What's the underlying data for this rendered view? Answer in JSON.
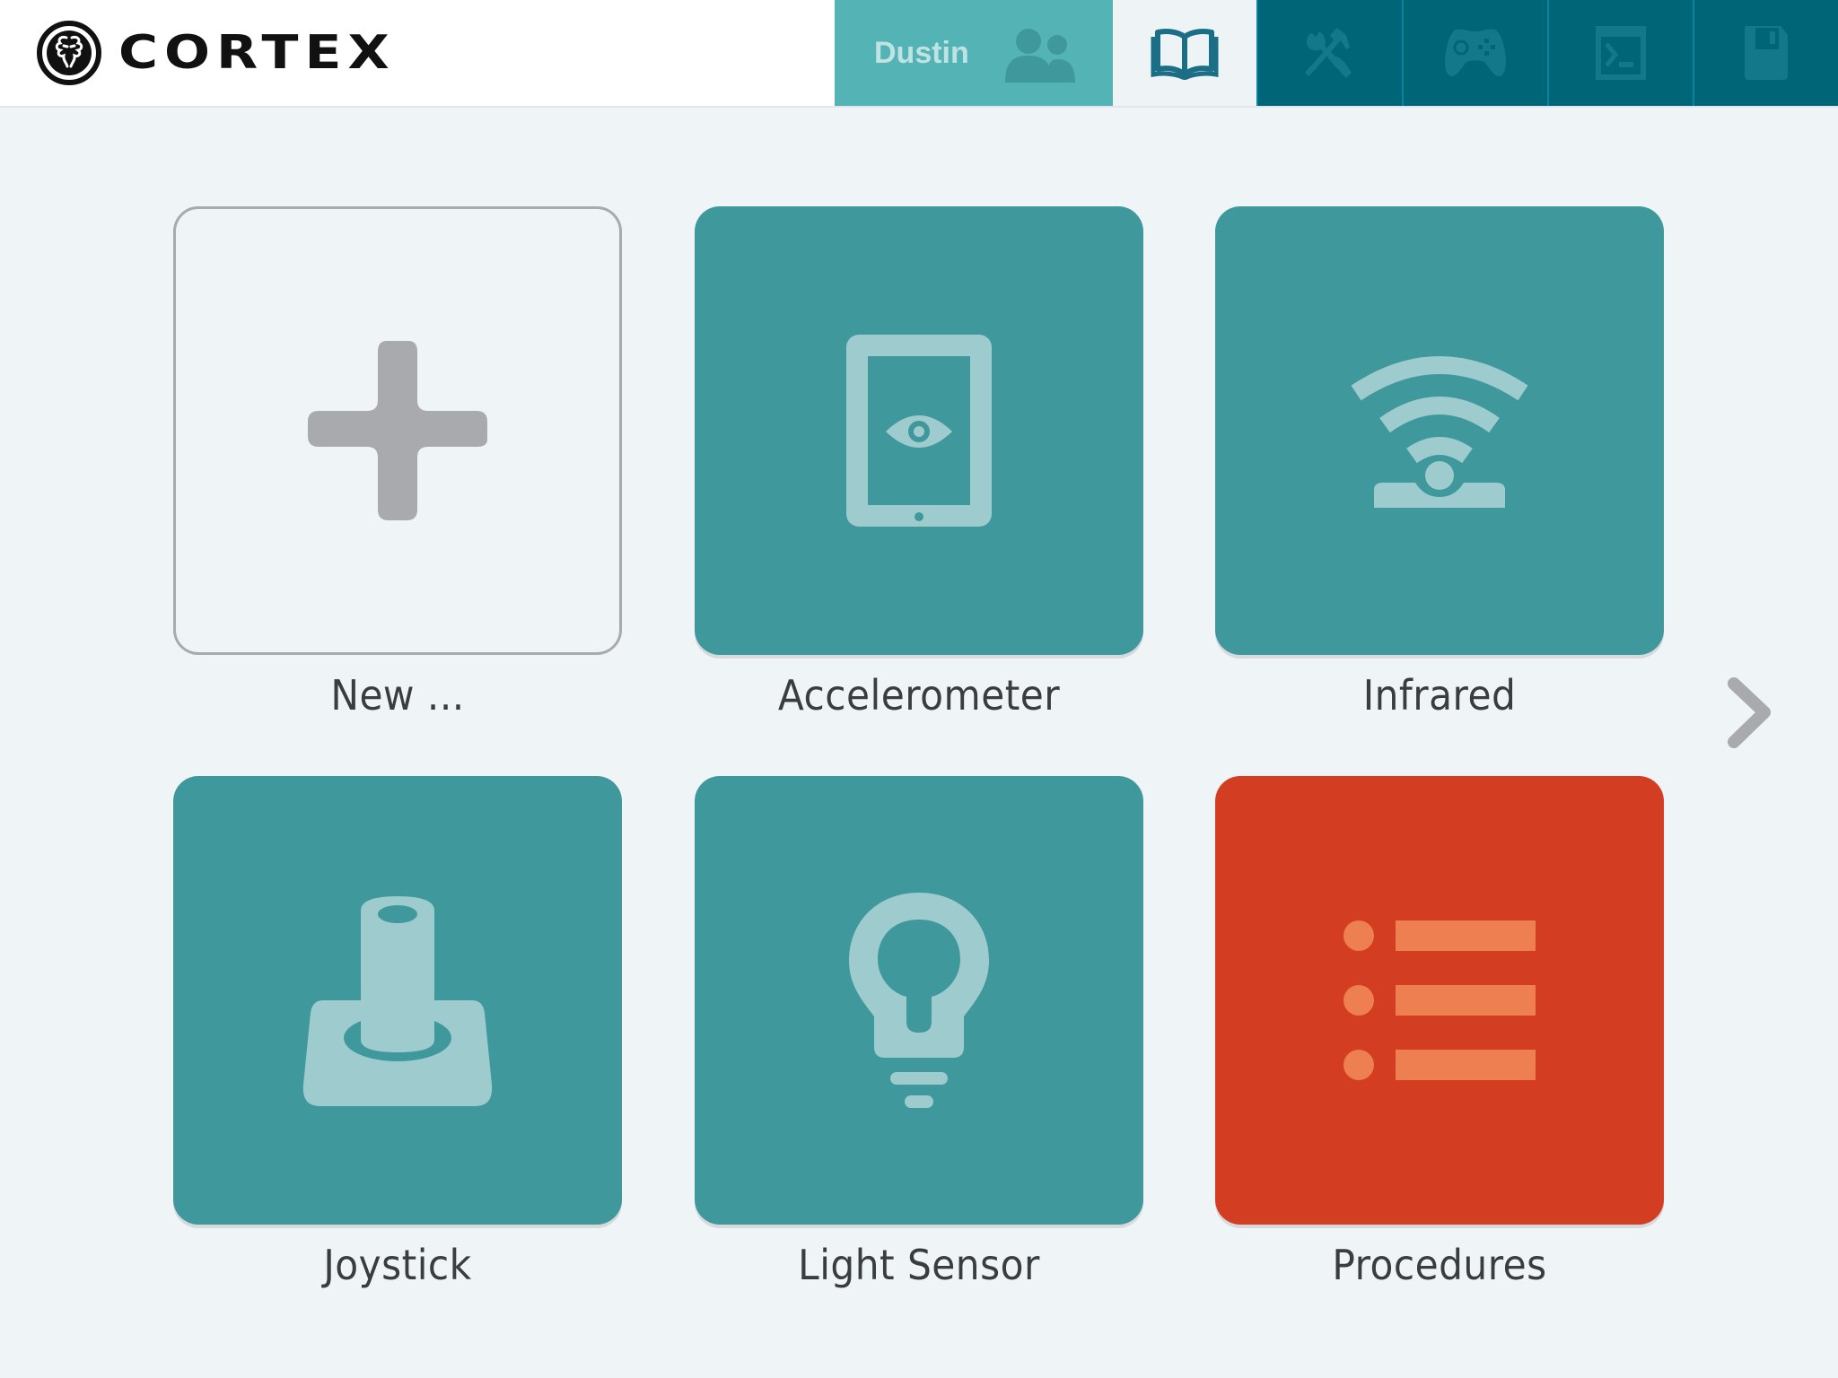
{
  "app": {
    "name": "CORTEX",
    "logo_icon": "brain-icon"
  },
  "header": {
    "user": {
      "name": "Dustin",
      "icon": "users-icon",
      "color": "#54b3b5"
    },
    "tabs": [
      {
        "id": "library",
        "icon": "book-icon",
        "active": true
      },
      {
        "id": "tools",
        "icon": "tools-icon",
        "active": false
      },
      {
        "id": "controller",
        "icon": "gamepad-icon",
        "active": false
      },
      {
        "id": "console",
        "icon": "terminal-icon",
        "active": false
      },
      {
        "id": "save",
        "icon": "floppy-disk-icon",
        "active": false
      }
    ]
  },
  "colors": {
    "background": "#eff4f7",
    "teal_tile": "#3f989c",
    "icon_on_teal": "#9ecbce",
    "red_tile": "#d33e23",
    "icon_on_red": "#ee7f50",
    "nav_dark": "#006577",
    "new_border": "#a8aaad"
  },
  "tiles": [
    {
      "label": "New ...",
      "icon": "plus-icon",
      "style": "new"
    },
    {
      "label": "Accelerometer",
      "icon": "tablet-eye-icon",
      "style": "teal"
    },
    {
      "label": "Infrared",
      "icon": "infrared-signal-icon",
      "style": "teal"
    },
    {
      "label": "Joystick",
      "icon": "joystick-icon",
      "style": "teal"
    },
    {
      "label": "Light Sensor",
      "icon": "lightbulb-icon",
      "style": "teal"
    },
    {
      "label": "Procedures",
      "icon": "list-icon",
      "style": "red"
    }
  ],
  "pagination": {
    "next_icon": "chevron-right-icon"
  }
}
